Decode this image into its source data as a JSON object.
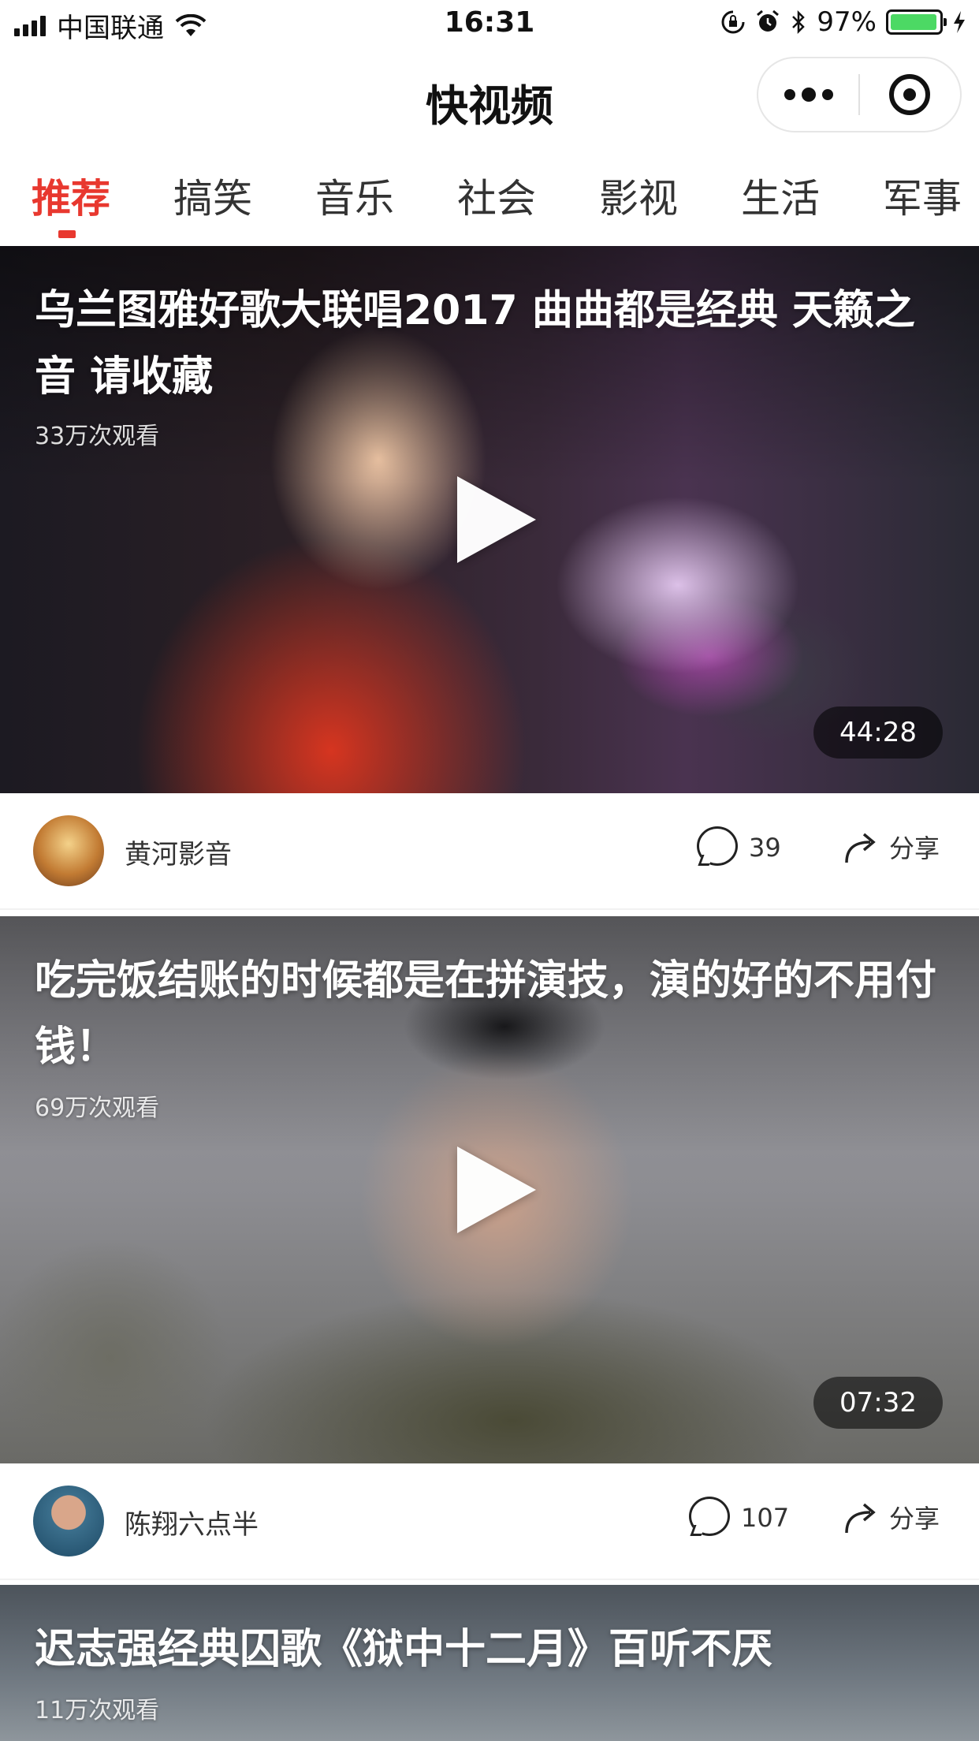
{
  "status_bar": {
    "carrier": "中国联通",
    "time": "16:31",
    "battery_percent": "97%",
    "battery_level": 0.97
  },
  "nav": {
    "title": "快视频"
  },
  "tabs": [
    {
      "label": "推荐",
      "active": true
    },
    {
      "label": "搞笑",
      "active": false
    },
    {
      "label": "音乐",
      "active": false
    },
    {
      "label": "社会",
      "active": false
    },
    {
      "label": "影视",
      "active": false
    },
    {
      "label": "生活",
      "active": false
    },
    {
      "label": "军事",
      "active": false
    }
  ],
  "videos": [
    {
      "title": "乌兰图雅好歌大联唱2017 曲曲都是经典 天籁之音 请收藏",
      "views": "33万次观看",
      "duration": "44:28",
      "author": "黄河影音",
      "comments": "39",
      "share_label": "分享"
    },
    {
      "title": "吃完饭结账的时候都是在拼演技，演的好的不用付钱！",
      "views": "69万次观看",
      "duration": "07:32",
      "author": "陈翔六点半",
      "comments": "107",
      "share_label": "分享"
    },
    {
      "title": "迟志强经典囚歌《狱中十二月》百听不厌",
      "views": "11万次观看"
    }
  ],
  "colors": {
    "accent": "#e8382f",
    "battery": "#4cd964"
  },
  "icons": [
    "signal-icon",
    "wifi-icon",
    "lock-rotation-icon",
    "alarm-icon",
    "bluetooth-icon",
    "battery-icon",
    "charging-icon",
    "more-icon",
    "target-icon",
    "play-icon",
    "comment-icon",
    "share-icon"
  ]
}
